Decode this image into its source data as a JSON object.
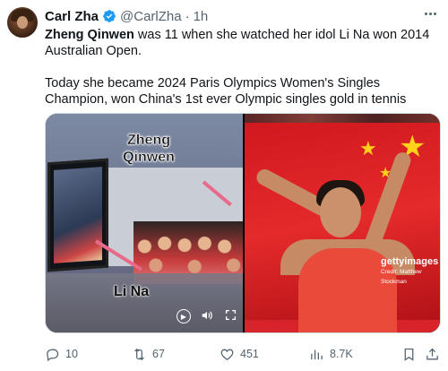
{
  "author": {
    "name": "Carl Zha",
    "handle": "@CarlZha",
    "separator": "·",
    "time": "1h"
  },
  "tweet": {
    "line1_bold": "Zheng Qinwen",
    "line1_rest": " was 11 when she watched her idol Li Na won 2014 Australian Open.",
    "line2": "Today she became 2024 Paris Olympics Women's Singles Champion, won China's 1st ever Olympic singles gold in tennis"
  },
  "media": {
    "left_caption_top": "Zheng\nQinwen",
    "left_caption_bottom": "Li Na",
    "right_watermark": "gettyimages",
    "right_credit": "Credit: Matthew Stockman"
  },
  "stats": {
    "replies": "10",
    "reposts": "67",
    "likes": "451",
    "views": "8.7K"
  },
  "icons": {
    "verified": "verified-badge-icon",
    "more": "more-icon",
    "reply": "reply-icon",
    "repost": "repost-icon",
    "like": "like-icon",
    "views": "views-icon",
    "bookmark": "bookmark-icon",
    "share": "share-icon"
  },
  "colors": {
    "verified": "#1d9bf0",
    "muted": "#536471",
    "text": "#0f1419"
  }
}
